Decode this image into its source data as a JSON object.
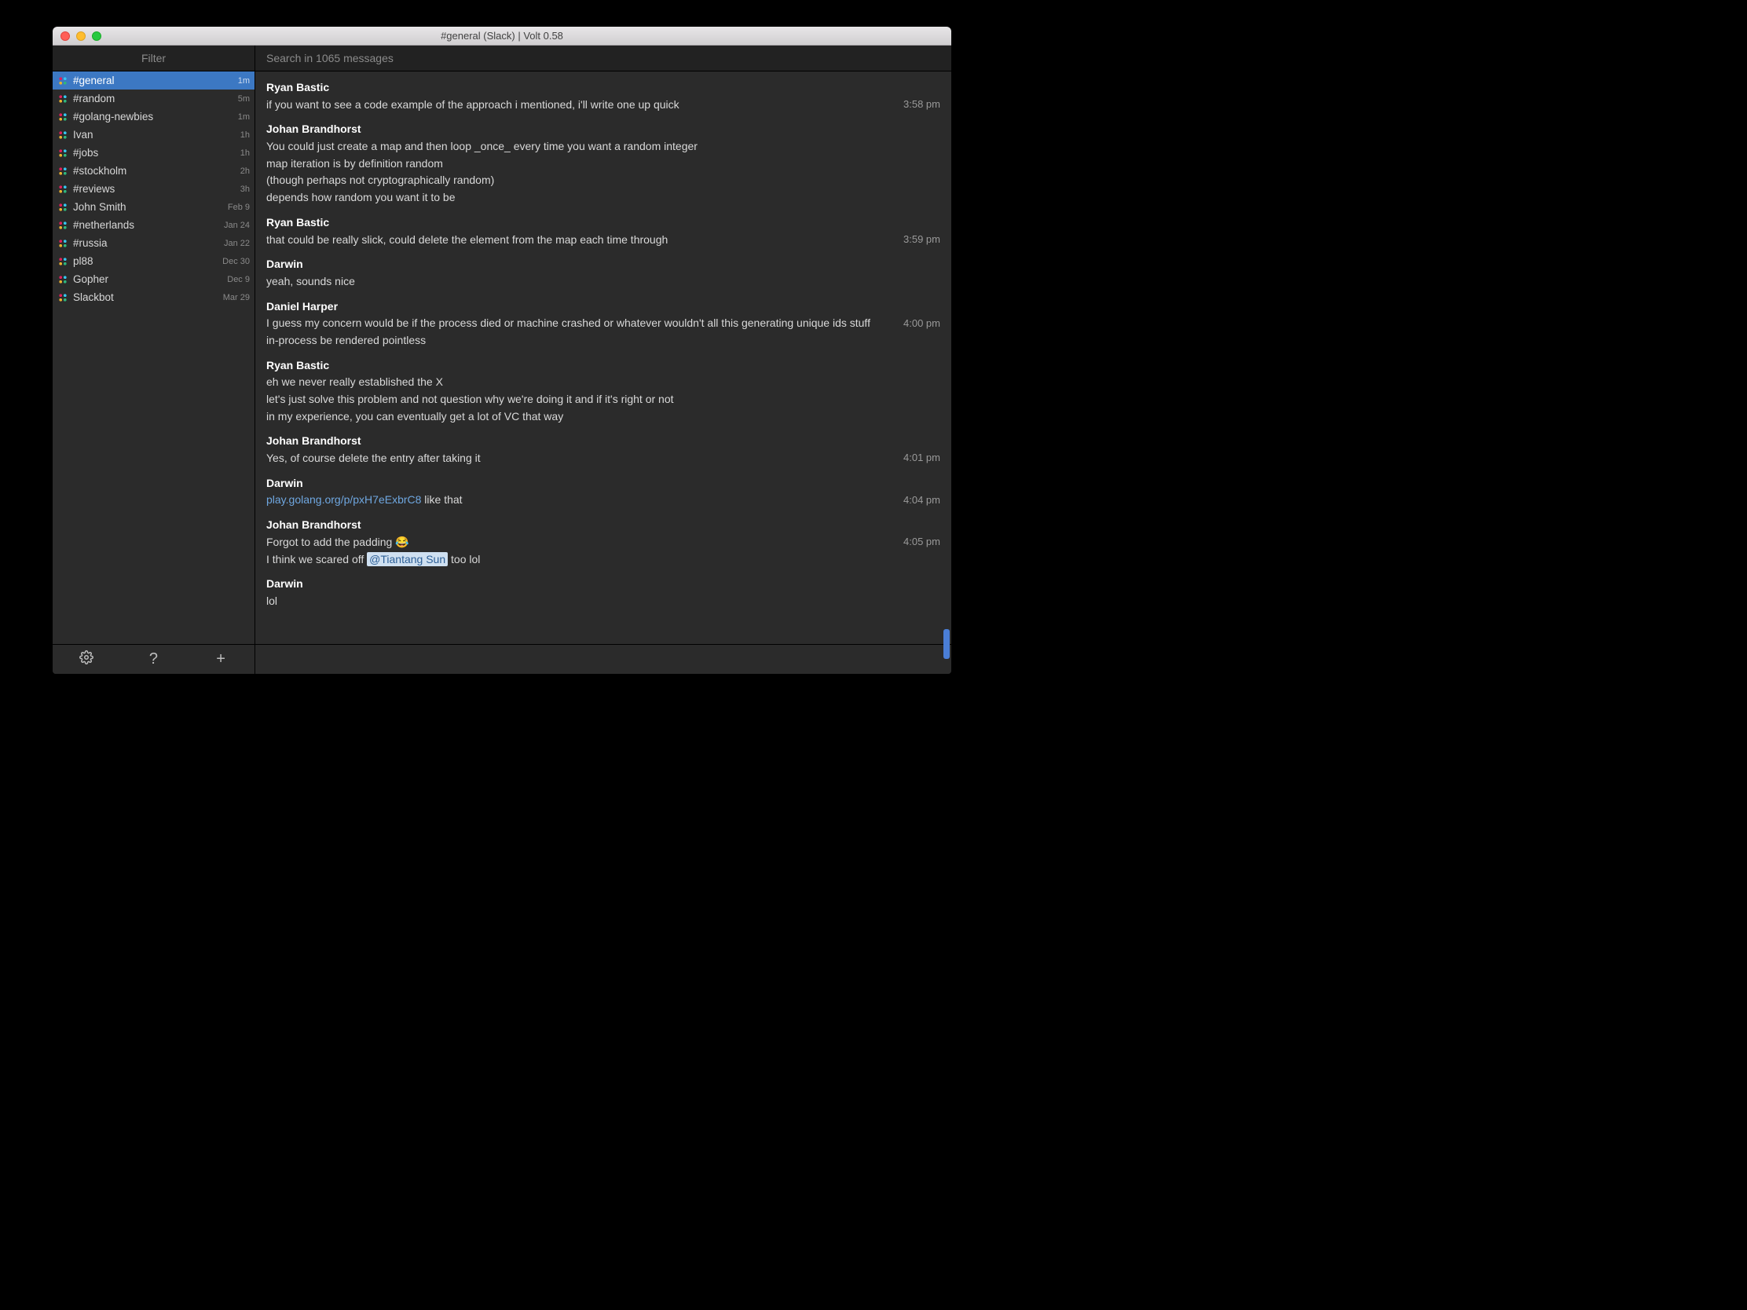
{
  "window": {
    "title": "#general (Slack)    |    Volt 0.58"
  },
  "toolbar": {
    "filter_label": "Filter",
    "search_placeholder": "Search in 1065 messages"
  },
  "sidebar": {
    "channels": [
      {
        "name": "#general",
        "time": "1m",
        "selected": true
      },
      {
        "name": "#random",
        "time": "5m",
        "selected": false
      },
      {
        "name": "#golang-newbies",
        "time": "1m",
        "selected": false
      },
      {
        "name": "Ivan",
        "time": "1h",
        "selected": false
      },
      {
        "name": "#jobs",
        "time": "1h",
        "selected": false
      },
      {
        "name": "#stockholm",
        "time": "2h",
        "selected": false
      },
      {
        "name": "#reviews",
        "time": "3h",
        "selected": false
      },
      {
        "name": "John Smith",
        "time": "Feb 9",
        "selected": false
      },
      {
        "name": "#netherlands",
        "time": "Jan 24",
        "selected": false
      },
      {
        "name": "#russia",
        "time": "Jan 22",
        "selected": false
      },
      {
        "name": "pl88",
        "time": "Dec 30",
        "selected": false
      },
      {
        "name": "Gopher",
        "time": "Dec 9",
        "selected": false
      },
      {
        "name": "Slackbot",
        "time": "Mar 29",
        "selected": false
      }
    ],
    "footer": {
      "settings": "⚙",
      "help": "?",
      "compose": "+"
    }
  },
  "messages": [
    {
      "author": "Ryan Bastic",
      "time": "3:58 pm",
      "lines": [
        {
          "text": "if you want to see a code example of the approach i mentioned, i'll write one up quick"
        }
      ]
    },
    {
      "author": "Johan Brandhorst",
      "time": "",
      "lines": [
        {
          "text": "You could just create a map and then loop _once_ every time you want a random integer"
        },
        {
          "text": "map iteration is by definition random"
        },
        {
          "text": "(though perhaps not cryptographically random)"
        },
        {
          "text": "depends how random you want it to be"
        }
      ]
    },
    {
      "author": "Ryan Bastic",
      "time": "3:59 pm",
      "lines": [
        {
          "text": "that could be really slick, could delete the element from the map each time through"
        }
      ]
    },
    {
      "author": "Darwin",
      "time": "",
      "lines": [
        {
          "text": "yeah, sounds nice"
        }
      ]
    },
    {
      "author": "Daniel Harper",
      "time": "4:00 pm",
      "lines": [
        {
          "text": "I guess my concern would be if the process died or machine crashed or whatever wouldn't all this generating unique ids stuff in-process be rendered pointless"
        }
      ]
    },
    {
      "author": "Ryan Bastic",
      "time": "",
      "lines": [
        {
          "text": "eh we never really established the X"
        },
        {
          "text": "let's just solve this problem and not question why we're doing it and if it's right or not"
        },
        {
          "text": "in my experience, you can eventually get a lot of VC that way"
        }
      ]
    },
    {
      "author": "Johan Brandhorst",
      "time": "4:01 pm",
      "lines": [
        {
          "text": "Yes, of course delete the entry after taking it"
        }
      ]
    },
    {
      "author": "Darwin",
      "time": "4:04 pm",
      "lines": [
        {
          "link": "play.golang.org/p/pxH7eExbrC8",
          "after": "  like that"
        }
      ]
    },
    {
      "author": "Johan Brandhorst",
      "time": "4:05 pm",
      "lines": [
        {
          "text": "Forgot to add the padding 😂"
        },
        {
          "before": "I think we scared off ",
          "mention": "@Tiantang Sun",
          "after": "  too lol"
        }
      ]
    },
    {
      "author": "Darwin",
      "time": "",
      "lines": [
        {
          "text": "lol"
        }
      ]
    }
  ]
}
